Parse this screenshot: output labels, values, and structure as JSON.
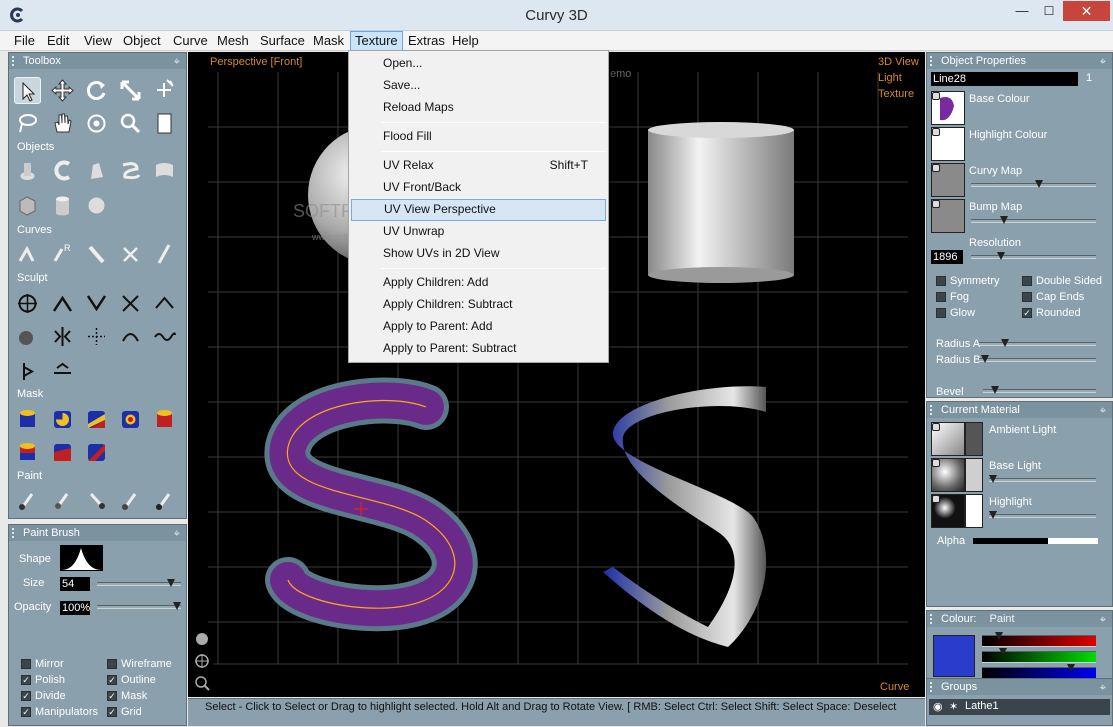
{
  "window": {
    "title": "Curvy 3D",
    "min_glyph": "—",
    "max_glyph": "☐",
    "close_glyph": "✕"
  },
  "menu": {
    "items": [
      "File",
      "Edit",
      "View",
      "Object",
      "Curve",
      "Mesh",
      "Surface",
      "Mask",
      "Texture",
      "Extras",
      "Help"
    ],
    "active": "Texture"
  },
  "dropdown": {
    "items": [
      {
        "label": "Open...",
        "shortcut": ""
      },
      {
        "label": "Save...",
        "shortcut": ""
      },
      {
        "label": "Reload Maps",
        "shortcut": ""
      },
      {
        "label": "Flood Fill",
        "shortcut": ""
      },
      {
        "label": "UV Relax",
        "shortcut": "Shift+T"
      },
      {
        "label": "UV Front/Back",
        "shortcut": ""
      },
      {
        "label": "UV View Perspective",
        "shortcut": ""
      },
      {
        "label": "UV Unwrap",
        "shortcut": ""
      },
      {
        "label": "Show UVs in 2D View",
        "shortcut": ""
      },
      {
        "label": "Apply Children: Add",
        "shortcut": ""
      },
      {
        "label": "Apply Children: Subtract",
        "shortcut": ""
      },
      {
        "label": "Apply to Parent: Add",
        "shortcut": ""
      },
      {
        "label": "Apply to Parent: Subtract",
        "shortcut": ""
      }
    ],
    "highlighted": "UV View Perspective"
  },
  "toolbox": {
    "title": "Toolbox",
    "sections": [
      "Objects",
      "Curves",
      "Sculpt",
      "Mask",
      "Paint"
    ]
  },
  "paint_brush": {
    "title": "Paint Brush",
    "shape_label": "Shape",
    "size_label": "Size",
    "size_value": "54",
    "size_level": 0.92,
    "opacity_label": "Opacity",
    "opacity_value": "100%",
    "opacity_level": 1.0,
    "checkboxes": [
      {
        "label": "Mirror",
        "checked": false
      },
      {
        "label": "Wireframe",
        "checked": false
      },
      {
        "label": "Polish",
        "checked": true
      },
      {
        "label": "Outline",
        "checked": true
      },
      {
        "label": "Divide",
        "checked": true
      },
      {
        "label": "Mask",
        "checked": true
      },
      {
        "label": "Manipulators",
        "checked": true
      },
      {
        "label": "Grid",
        "checked": true
      }
    ]
  },
  "viewport": {
    "view_label": "Perspective [Front]",
    "right_labels": [
      "3D View",
      "Light",
      "Texture"
    ],
    "bottom_right_label": "Curve",
    "watermark": "SOFTPEDIA",
    "watermark_url": "www.softpedia.com",
    "demo_fragment": "emo",
    "colors": {
      "purple": "#6a2a8a",
      "blue": "#1c2fa8"
    }
  },
  "status": {
    "text": "Select - Click to Select or Drag to highlight selected. Hold Alt and Drag to Rotate View. [ RMB: Select  Ctrl: Select  Shift: Select  Space: Deselect"
  },
  "object_properties": {
    "title": "Object Properties",
    "name_value": "Line28",
    "index_value": "1",
    "rows": [
      {
        "label": "Base Colour",
        "slider": null
      },
      {
        "label": "Highlight Colour",
        "slider": null
      },
      {
        "label": "Curvy Map",
        "slider": 0.55
      },
      {
        "label": "Bump Map",
        "slider": 0.25
      }
    ],
    "resolution_label": "Resolution",
    "resolution_value": "1896",
    "resolution_level": 0.22,
    "checks": [
      {
        "label": "Symmetry",
        "checked": false
      },
      {
        "label": "Double Sided",
        "checked": false
      },
      {
        "label": "Fog",
        "checked": false
      },
      {
        "label": "Cap Ends",
        "checked": false
      },
      {
        "label": "Glow",
        "checked": false
      },
      {
        "label": "Rounded",
        "checked": true
      }
    ],
    "radius_a_label": "Radius A",
    "radius_a_level": 0.2,
    "radius_b_label": "Radius B",
    "radius_b_level": 0.02,
    "bevel_label": "Bevel",
    "bevel_level": 0.08
  },
  "current_material": {
    "title": "Current Material",
    "rows": [
      {
        "label": "Ambient Light",
        "slider": null
      },
      {
        "label": "Base Light",
        "slider": 0.0
      },
      {
        "label": "Highlight",
        "slider": 0.0
      }
    ],
    "alpha_label": "Alpha",
    "alpha_level": 0.6
  },
  "colour": {
    "title": "Colour:",
    "mode": "Paint",
    "swatch": "#2a3ccc",
    "red_level": 0.12,
    "green_level": 0.16,
    "blue_level": 0.8
  },
  "groups": {
    "title": "Groups",
    "item": "Lathe1"
  }
}
